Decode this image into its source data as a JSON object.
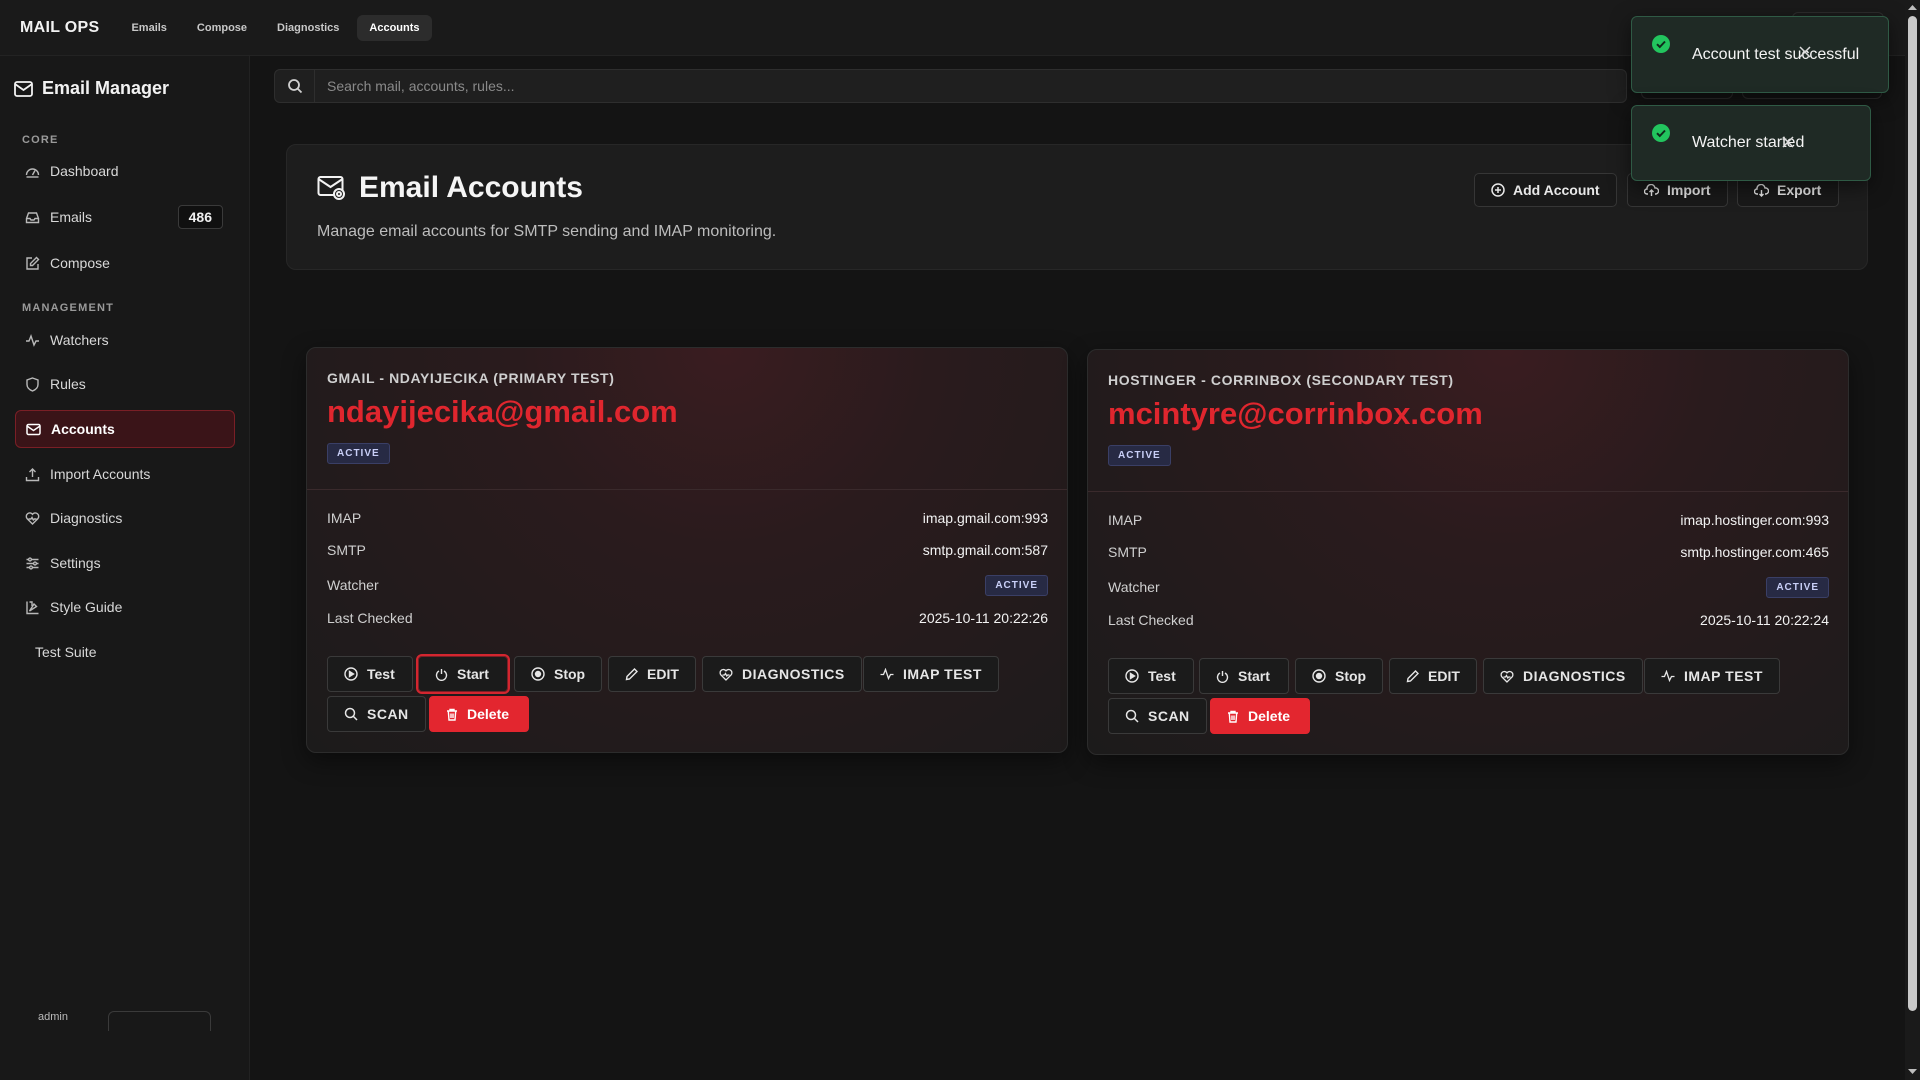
{
  "topbar": {
    "brand": "MAIL OPS",
    "nav": [
      {
        "label": "Emails"
      },
      {
        "label": "Compose"
      },
      {
        "label": "Diagnostics"
      },
      {
        "label": "Accounts",
        "active": true
      }
    ]
  },
  "sidebar": {
    "title": "Email Manager",
    "sections": {
      "core": "CORE",
      "management": "MANAGEMENT"
    },
    "items": [
      {
        "label": "Dashboard",
        "icon": "dashboard-icon"
      },
      {
        "label": "Emails",
        "icon": "inbox-icon",
        "count": "486"
      },
      {
        "label": "Compose",
        "icon": "compose-icon"
      },
      {
        "label": "Watchers",
        "icon": "activity-icon"
      },
      {
        "label": "Rules",
        "icon": "shield-icon"
      },
      {
        "label": "Accounts",
        "icon": "mail-icon",
        "active": true
      },
      {
        "label": "Import Accounts",
        "icon": "upload-icon"
      },
      {
        "label": "Diagnostics",
        "icon": "heart-pulse-icon"
      },
      {
        "label": "Settings",
        "icon": "sliders-icon"
      },
      {
        "label": "Style Guide",
        "icon": "palette-icon"
      },
      {
        "label": "Test Suite",
        "icon": ""
      }
    ],
    "footer_user": "admin"
  },
  "search": {
    "placeholder": "Search mail, accounts, rules..."
  },
  "header": {
    "title": "Email Accounts",
    "subtitle": "Manage email accounts for SMTP sending and IMAP monitoring.",
    "buttons": {
      "add": "Add Account",
      "import": "Import",
      "export": "Export"
    }
  },
  "accounts": [
    {
      "label": "GMAIL - NDAYIJECIKA (PRIMARY TEST)",
      "email": "ndayijecika@gmail.com",
      "status": "ACTIVE",
      "imap_key": "IMAP",
      "imap": "imap.gmail.com:993",
      "smtp_key": "SMTP",
      "smtp": "smtp.gmail.com:587",
      "watcher_key": "Watcher",
      "watcher": "ACTIVE",
      "checked_key": "Last Checked",
      "last_checked": "2025-10-11 20:22:26"
    },
    {
      "label": "HOSTINGER - CORRINBOX (SECONDARY TEST)",
      "email": "mcintyre@corrinbox.com",
      "status": "ACTIVE",
      "imap_key": "IMAP",
      "imap": "imap.hostinger.com:993",
      "smtp_key": "SMTP",
      "smtp": "smtp.hostinger.com:465",
      "watcher_key": "Watcher",
      "watcher": "ACTIVE",
      "checked_key": "Last Checked",
      "last_checked": "2025-10-11 20:22:24"
    }
  ],
  "card_buttons": {
    "test": "Test",
    "start": "Start",
    "stop": "Stop",
    "edit": "EDIT",
    "diagnostics": "DIAGNOSTICS",
    "imap_test": "IMAP TEST",
    "scan": "SCAN",
    "delete": "Delete"
  },
  "toasts": [
    {
      "message": "Account test successful"
    },
    {
      "message": "Watcher started"
    }
  ],
  "colors": {
    "accent": "#e0262e",
    "success": "#22c55e",
    "badge": "#272a44"
  }
}
